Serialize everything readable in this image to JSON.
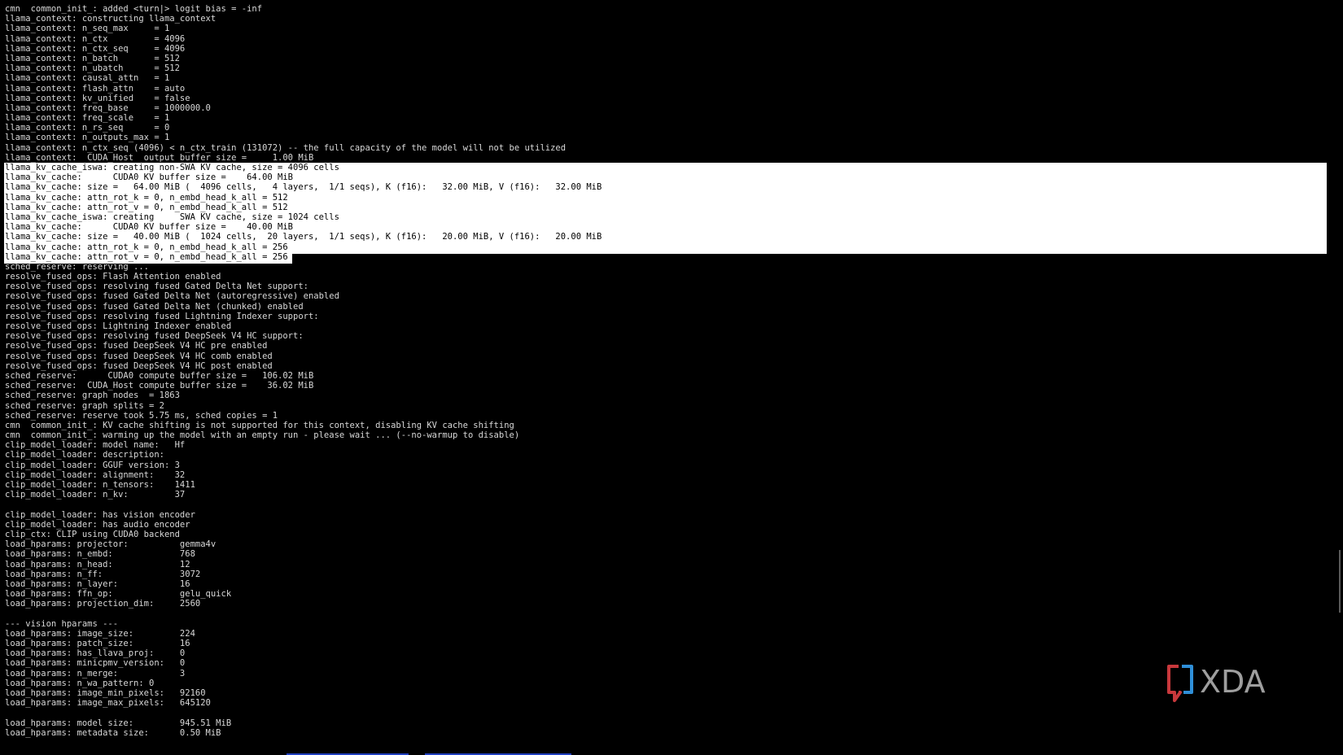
{
  "terminal": {
    "lines": [
      "cmn  common_init_: added <turn|> logit bias = -inf",
      "llama_context: constructing llama_context",
      "llama_context: n_seq_max     = 1",
      "llama_context: n_ctx         = 4096",
      "llama_context: n_ctx_seq     = 4096",
      "llama_context: n_batch       = 512",
      "llama_context: n_ubatch      = 512",
      "llama_context: causal_attn   = 1",
      "llama_context: flash_attn    = auto",
      "llama_context: kv_unified    = false",
      "llama_context: freq_base     = 1000000.0",
      "llama_context: freq_scale    = 1",
      "llama_context: n_rs_seq      = 0",
      "llama_context: n_outputs_max = 1",
      "llama_context: n_ctx_seq (4096) < n_ctx_train (131072) -- the full capacity of the model will not be utilized",
      "llama_context:  CUDA_Host  output buffer size =     1.00 MiB",
      "llama_kv_cache_iswa: creating non-SWA KV cache, size = 4096 cells",
      "llama_kv_cache:      CUDA0 KV buffer size =    64.00 MiB",
      "llama_kv_cache: size =   64.00 MiB (  4096 cells,   4 layers,  1/1 seqs), K (f16):   32.00 MiB, V (f16):   32.00 MiB",
      "llama_kv_cache: attn_rot_k = 0, n_embd_head_k_all = 512",
      "llama_kv_cache: attn_rot_v = 0, n_embd_head_k_all = 512",
      "llama_kv_cache_iswa: creating     SWA KV cache, size = 1024 cells",
      "llama_kv_cache:      CUDA0 KV buffer size =    40.00 MiB",
      "llama_kv_cache: size =   40.00 MiB (  1024 cells,  20 layers,  1/1 seqs), K (f16):   20.00 MiB, V (f16):   20.00 MiB",
      "llama_kv_cache: attn_rot_k = 0, n_embd_head_k_all = 256",
      "llama_kv_cache: attn_rot_v = 0, n_embd_head_k_all = 256",
      "sched_reserve: reserving ...",
      "resolve_fused_ops: Flash Attention enabled",
      "resolve_fused_ops: resolving fused Gated Delta Net support:",
      "resolve_fused_ops: fused Gated Delta Net (autoregressive) enabled",
      "resolve_fused_ops: fused Gated Delta Net (chunked) enabled",
      "resolve_fused_ops: resolving fused Lightning Indexer support:",
      "resolve_fused_ops: Lightning Indexer enabled",
      "resolve_fused_ops: resolving fused DeepSeek V4 HC support:",
      "resolve_fused_ops: fused DeepSeek V4 HC pre enabled",
      "resolve_fused_ops: fused DeepSeek V4 HC comb enabled",
      "resolve_fused_ops: fused DeepSeek V4 HC post enabled",
      "sched_reserve:      CUDA0 compute buffer size =   106.02 MiB",
      "sched_reserve:  CUDA_Host compute buffer size =    36.02 MiB",
      "sched_reserve: graph nodes  = 1863",
      "sched_reserve: graph splits = 2",
      "sched_reserve: reserve took 5.75 ms, sched copies = 1",
      "cmn  common_init_: KV cache shifting is not supported for this context, disabling KV cache shifting",
      "cmn  common_init_: warming up the model with an empty run - please wait ... (--no-warmup to disable)",
      "clip_model_loader: model name:   Hf",
      "clip_model_loader: description:",
      "clip_model_loader: GGUF version: 3",
      "clip_model_loader: alignment:    32",
      "clip_model_loader: n_tensors:    1411",
      "clip_model_loader: n_kv:         37",
      "",
      "clip_model_loader: has vision encoder",
      "clip_model_loader: has audio encoder",
      "clip_ctx: CLIP using CUDA0 backend",
      "load_hparams: projector:          gemma4v",
      "load_hparams: n_embd:             768",
      "load_hparams: n_head:             12",
      "load_hparams: n_ff:               3072",
      "load_hparams: n_layer:            16",
      "load_hparams: ffn_op:             gelu_quick",
      "load_hparams: projection_dim:     2560",
      "",
      "--- vision hparams ---",
      "load_hparams: image_size:         224",
      "load_hparams: patch_size:         16",
      "load_hparams: has_llava_proj:     0",
      "load_hparams: minicpmv_version:   0",
      "load_hparams: n_merge:            3",
      "load_hparams: n_wa_pattern: 0",
      "load_hparams: image_min_pixels:   92160",
      "load_hparams: image_max_pixels:   645120",
      "",
      "load_hparams: model size:         945.51 MiB",
      "load_hparams: metadata size:      0.50 MiB"
    ],
    "selected_range": [
      16,
      25
    ]
  },
  "watermark": {
    "brand_text": "XDA",
    "colors": {
      "bracket_red": "#c8383c",
      "bracket_blue": "#2f8fd8",
      "letters": "#9e9e9e"
    }
  },
  "colors": {
    "background": "#000000",
    "text": "#d8d8d8",
    "selection": "#ffffff"
  }
}
